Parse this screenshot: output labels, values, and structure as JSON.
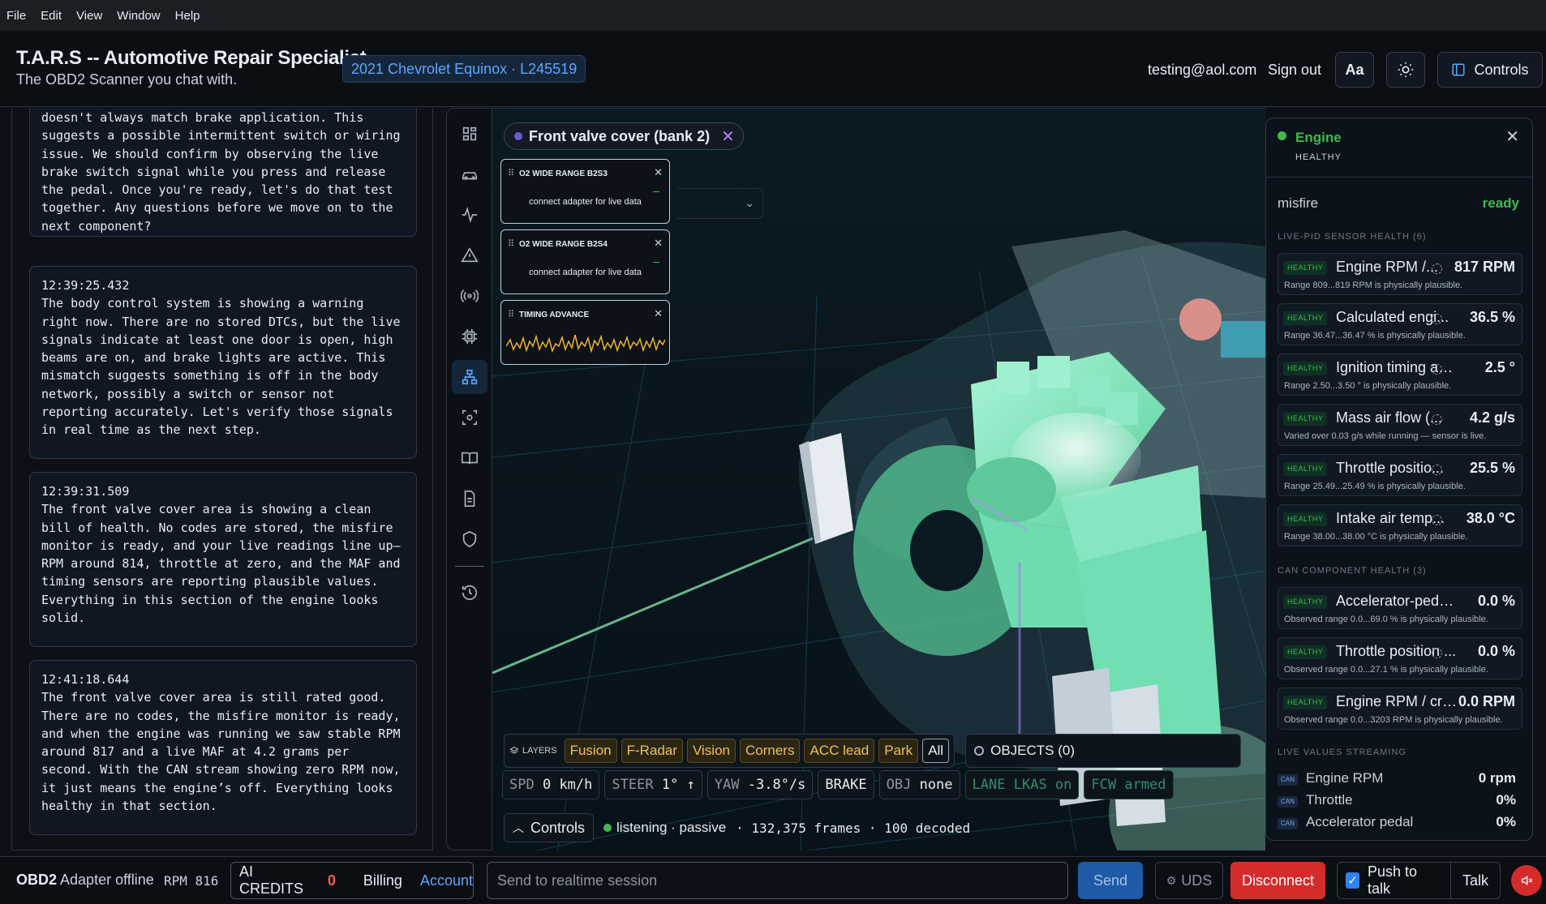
{
  "menu": [
    "File",
    "Edit",
    "View",
    "Window",
    "Help"
  ],
  "header": {
    "title": "T.A.R.S -- Automotive Repair Specialist",
    "subtitle": "The OBD2 Scanner you chat with.",
    "vehicle": "2021 Chevrolet Equinox · L245519",
    "email": "testing@aol.com",
    "signout": "Sign out",
    "font_btn": "Aa",
    "controls_btn": "Controls"
  },
  "chat": {
    "messages": [
      {
        "text": "doesn't always match brake application. This\nsuggests a possible intermittent switch or wiring\nissue. We should confirm by observing the live\nbrake switch signal while you press and release\nthe pedal. Once you're ready, let's do that test\ntogether. Any questions before we move on to the\nnext component?"
      },
      {
        "text": "12:39:25.432\nThe body control system is showing a warning\nright now. There are no stored DTCs, but the live\nsignals indicate at least one door is open, high\nbeams are on, and brake lights are active. This\nmismatch suggests something is off in the body\nnetwork, possibly a switch or sensor not\nreporting accurately. Let's verify those signals\nin real time as the next step."
      },
      {
        "text": "12:39:31.509\nThe front valve cover area is showing a clean\nbill of health. No codes are stored, the misfire\nmonitor is ready, and your live readings line up—\nRPM around 814, throttle at zero, and the MAF and\ntiming sensors are reporting plausible values.\nEverything in this section of the engine looks\nsolid."
      },
      {
        "text": "12:41:18.644\nThe front valve cover area is still rated good.\nThere are no codes, the misfire monitor is ready,\nand when the engine was running we saw stable RPM\naround 817 and a live MAF at 4.2 grams per\nsecond. With the CAN stream showing zero RPM now,\nit just means the engine’s off. Everything looks\nhealthy in that section."
      }
    ]
  },
  "toolbar": {
    "icons": [
      "grid-icon",
      "car-icon",
      "pulse-icon",
      "warning-icon",
      "broadcast-icon",
      "chip-icon",
      "network-icon",
      "scan-icon",
      "book-icon",
      "document-icon",
      "shield-icon",
      "history-icon"
    ],
    "active_index": 6
  },
  "viewport": {
    "component_chip": "Front valve cover (bank 2)",
    "pid_cards": [
      {
        "title": "O2 WIDE RANGE B2S3",
        "message": "connect adapter for live data"
      },
      {
        "title": "O2 WIDE RANGE B2S4",
        "message": "connect adapter for live data"
      },
      {
        "title": "TIMING ADVANCE",
        "message": ""
      }
    ],
    "layers_label": "LAYERS",
    "layers": [
      "Fusion",
      "F-Radar",
      "Vision",
      "Corners",
      "ACC lead",
      "Park",
      "All"
    ],
    "objects": "OBJECTS (0)",
    "telemetry": [
      {
        "label": "SPD",
        "value": "0  km/h"
      },
      {
        "label": "STEER",
        "value": "1°  ↑"
      },
      {
        "label": "YAW",
        "value": "-3.8°/s"
      },
      {
        "label": "",
        "value": "BRAKE"
      },
      {
        "label": "OBJ",
        "value": "none"
      },
      {
        "label": "LANE",
        "value": "LKAS  on"
      },
      {
        "label": "FCW",
        "value": "armed"
      }
    ],
    "controls_toggle": "Controls",
    "status_text": "listening · passive",
    "frames_text": "· 132,375 frames · 100 decoded"
  },
  "health": {
    "system": "Engine",
    "status": "HEALTHY",
    "misfire_label": "misfire",
    "misfire_value": "ready",
    "live_section": "LIVE-PID SENSOR HEALTH (6)",
    "live_cards": [
      {
        "badge": "HEALTHY",
        "name": "Engine RPM /...",
        "value": "817 RPM",
        "range": "Range 809...819 RPM is physically plausible."
      },
      {
        "badge": "HEALTHY",
        "name": "Calculated engi...",
        "value": "36.5 %",
        "range": "Range 36.47...36.47 % is physically plausible."
      },
      {
        "badge": "HEALTHY",
        "name": "Ignition timing ad...",
        "value": "2.5 °",
        "range": "Range 2.50...3.50 ° is physically plausible."
      },
      {
        "badge": "HEALTHY",
        "name": "Mass air flow (...",
        "value": "4.2 g/s",
        "range": "Varied over 0.03 g/s while running — sensor is live."
      },
      {
        "badge": "HEALTHY",
        "name": "Throttle positio...",
        "value": "25.5 %",
        "range": "Range 25.49...25.49 % is physically plausible."
      },
      {
        "badge": "HEALTHY",
        "name": "Intake air temp...",
        "value": "38.0 °C",
        "range": "Range 38.00...38.00 °C is physically plausible."
      }
    ],
    "can_section": "CAN COMPONENT HEALTH (3)",
    "can_cards": [
      {
        "badge": "HEALTHY",
        "name": "Accelerator-pedal p...",
        "value": "0.0 %",
        "range": "Observed range 0.0...69.0 % is physically plausible."
      },
      {
        "badge": "HEALTHY",
        "name": "Throttle position ...",
        "value": "0.0 %",
        "range": "Observed range 0.0...27.1 % is physically plausible."
      },
      {
        "badge": "HEALTHY",
        "name": "Engine RPM / cra...",
        "value": "0.0 RPM",
        "range": "Observed range 0.0...3203 RPM is physically plausible."
      }
    ],
    "stream_section": "LIVE VALUES STREAMING",
    "stream": [
      {
        "tag": "CAN",
        "name": "Engine RPM",
        "value": "0 rpm"
      },
      {
        "tag": "CAN",
        "name": "Throttle",
        "value": "0%"
      },
      {
        "tag": "CAN",
        "name": "Accelerator pedal",
        "value": "0%"
      }
    ]
  },
  "bottombar": {
    "obd": "OBD2",
    "offline": "Adapter offline",
    "rpm": "RPM 816",
    "credits_label": "AI CREDITS",
    "credits_value": "0",
    "billing": "Billing",
    "account": "Account",
    "input_placeholder": "Send to realtime session",
    "send": "Send",
    "uds": "UDS",
    "disconnect": "Disconnect",
    "push_to_talk": "Push to talk",
    "talk": "Talk"
  },
  "colors": {
    "accent_blue": "#2f81f7",
    "healthy_green": "#3fb950",
    "layer_gold": "#f0c24a",
    "danger_red": "#d62b2b",
    "engine_mint": "#6fe0b0"
  }
}
